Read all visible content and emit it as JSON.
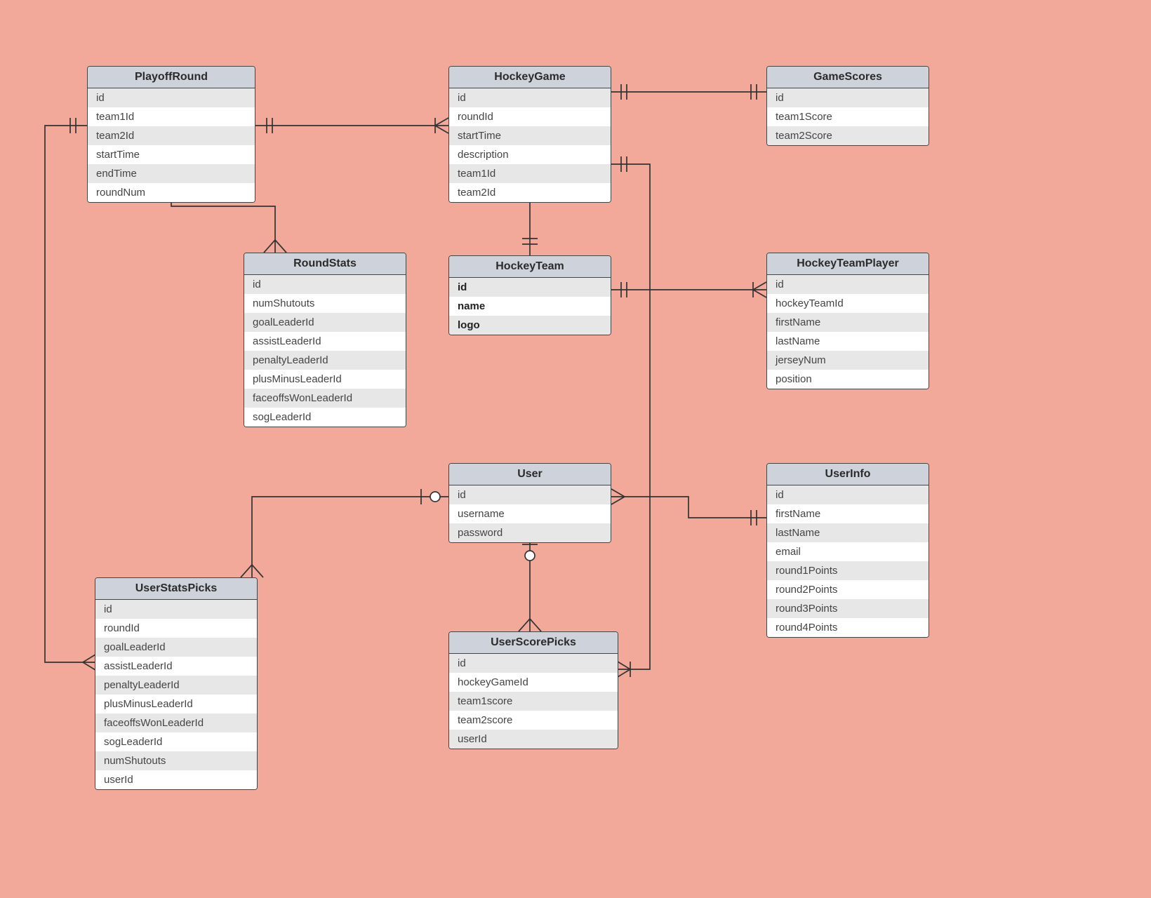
{
  "entities": {
    "playoffRound": {
      "title": "PlayoffRound",
      "fields": [
        "id",
        "team1Id",
        "team2Id",
        "startTime",
        "endTime",
        "roundNum"
      ]
    },
    "hockeyGame": {
      "title": "HockeyGame",
      "fields": [
        "id",
        "roundId",
        "startTime",
        "description",
        "team1Id",
        "team2Id"
      ]
    },
    "gameScores": {
      "title": "GameScores",
      "fields": [
        "id",
        "team1Score",
        "team2Score"
      ]
    },
    "roundStats": {
      "title": "RoundStats",
      "fields": [
        "id",
        "numShutouts",
        "goalLeaderId",
        "assistLeaderId",
        "penaltyLeaderId",
        "plusMinusLeaderId",
        "faceoffsWonLeaderId",
        "sogLeaderId"
      ]
    },
    "hockeyTeam": {
      "title": "HockeyTeam",
      "fields": [
        "id",
        "name",
        "logo"
      ],
      "bold": true
    },
    "hockeyTeamPlayer": {
      "title": "HockeyTeamPlayer",
      "fields": [
        "id",
        "hockeyTeamId",
        "firstName",
        "lastName",
        "jerseyNum",
        "position"
      ]
    },
    "user": {
      "title": "User",
      "fields": [
        "id",
        "username",
        "password"
      ]
    },
    "userInfo": {
      "title": "UserInfo",
      "fields": [
        "id",
        "firstName",
        "lastName",
        "email",
        "round1Points",
        "round2Points",
        "round3Points",
        "round4Points"
      ]
    },
    "userStatsPicks": {
      "title": "UserStatsPicks",
      "fields": [
        "id",
        "roundId",
        "goalLeaderId",
        "assistLeaderId",
        "penaltyLeaderId",
        "plusMinusLeaderId",
        "faceoffsWonLeaderId",
        "sogLeaderId",
        "numShutouts",
        "userId"
      ]
    },
    "userScorePicks": {
      "title": "UserScorePicks",
      "fields": [
        "id",
        "hockeyGameId",
        "team1score",
        "team2score",
        "userId"
      ]
    }
  }
}
